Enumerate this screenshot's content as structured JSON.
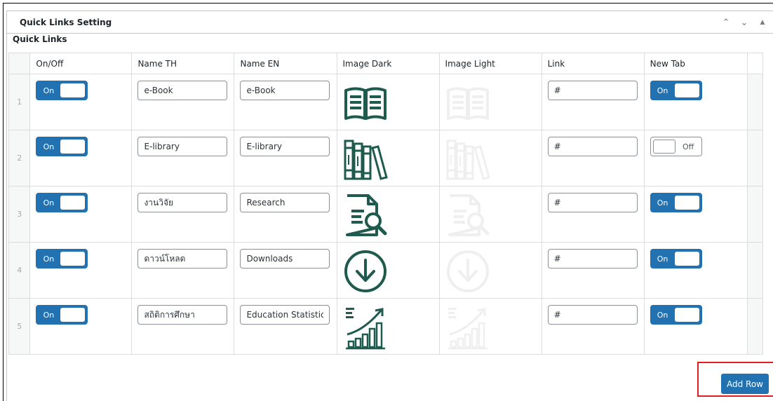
{
  "panel": {
    "title": "Quick Links Setting",
    "field_label": "Quick Links"
  },
  "table": {
    "columns": [
      "On/Off",
      "Name TH",
      "Name EN",
      "Image Dark",
      "Image Light",
      "Link",
      "New Tab"
    ],
    "rows": [
      {
        "num": "1",
        "on_off": "On",
        "name_th": "e-Book",
        "name_en": "e-Book",
        "image": "book-icon",
        "link": "#",
        "new_tab": "On",
        "new_tab_on": true
      },
      {
        "num": "2",
        "on_off": "On",
        "name_th": "E-library",
        "name_en": "E-library",
        "image": "library-books-icon",
        "link": "#",
        "new_tab": "Off",
        "new_tab_on": false
      },
      {
        "num": "3",
        "on_off": "On",
        "name_th": "งานวิจัย",
        "name_en": "Research",
        "image": "research-document-icon",
        "link": "#",
        "new_tab": "On",
        "new_tab_on": true
      },
      {
        "num": "4",
        "on_off": "On",
        "name_th": "ดาวน์โหลด",
        "name_en": "Downloads",
        "image": "download-circle-icon",
        "link": "#",
        "new_tab": "On",
        "new_tab_on": true
      },
      {
        "num": "5",
        "on_off": "On",
        "name_th": "สถิติการศึกษา",
        "name_en": "Education Statistics",
        "image": "statistics-chart-icon",
        "link": "#",
        "new_tab": "On",
        "new_tab_on": true
      }
    ]
  },
  "add_row_label": "Add Row",
  "colors": {
    "accent": "#2271b1",
    "icon_dark": "#1f5a4e",
    "icon_light": "#efefef",
    "highlight_box": "#e01e24"
  }
}
